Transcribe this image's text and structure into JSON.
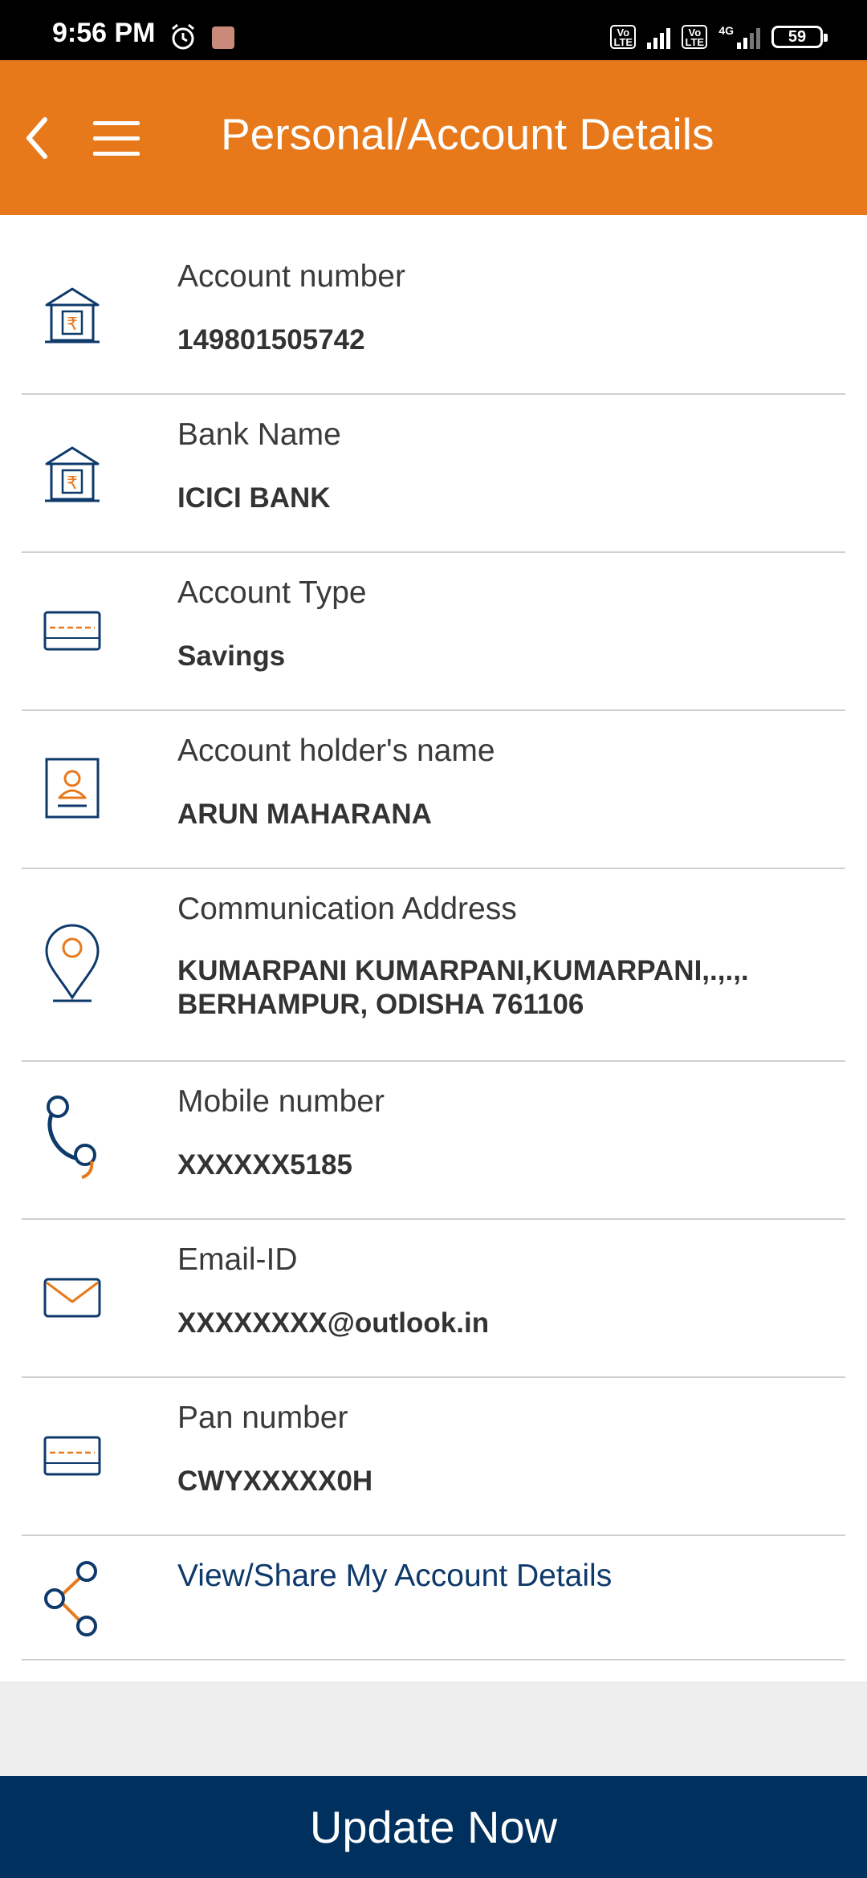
{
  "status_bar": {
    "time": "9:56 PM",
    "sim1_label": "Vo LTE",
    "sim2_label": "Vo LTE",
    "network": "4G",
    "battery": "59"
  },
  "header": {
    "title": "Personal/Account Details",
    "back_icon": "back-arrow-icon",
    "menu_icon": "hamburger-menu-icon",
    "background_color": "#e8791b"
  },
  "details": [
    {
      "label": "Account number",
      "value": "149801505742",
      "icon": "bank-rupee-icon"
    },
    {
      "label": "Bank Name",
      "value": "ICICI BANK",
      "icon": "bank-rupee-icon"
    },
    {
      "label": "Account Type",
      "value": "Savings",
      "icon": "card-icon"
    },
    {
      "label": "Account holder's name",
      "value": "ARUN MAHARANA",
      "icon": "id-card-icon"
    },
    {
      "label": "Communication Address",
      "value": "KUMARPANI KUMARPANI,KUMARPANI,.,.,. BERHAMPUR, ODISHA 761106",
      "icon": "location-pin-icon"
    },
    {
      "label": "Mobile number",
      "value": "XXXXXX5185",
      "icon": "phone-icon"
    },
    {
      "label": "Email-ID",
      "value": "XXXXXXXX@outlook.in",
      "icon": "envelope-icon"
    },
    {
      "label": "Pan number",
      "value": "CWYXXXXX0H",
      "icon": "card-icon"
    }
  ],
  "share": {
    "label": "View/Share My Account Details",
    "icon": "share-icon"
  },
  "footer": {
    "button_label": "Update Now",
    "background_color": "#00305e"
  },
  "colors": {
    "accent": "#e8791b",
    "navy": "#0e3a6b"
  }
}
